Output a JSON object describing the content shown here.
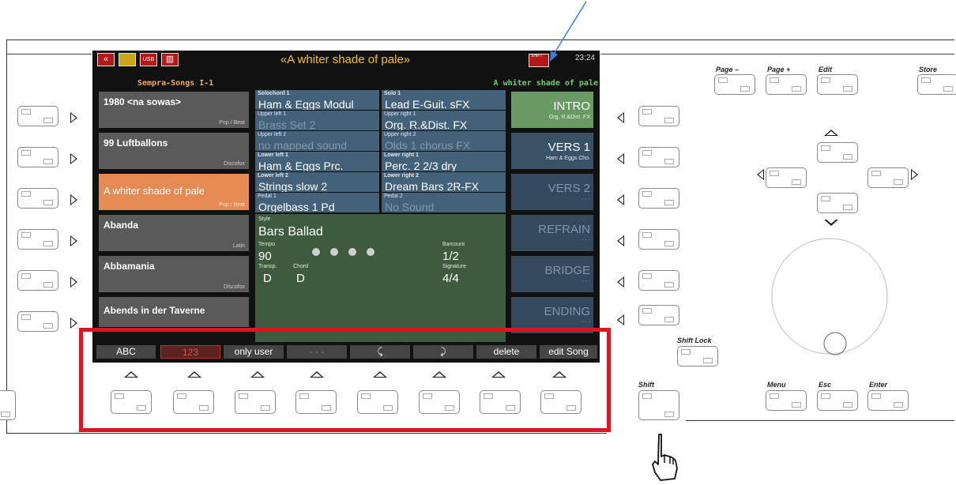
{
  "screen": {
    "song_title": "«A whiter shade of pale»",
    "clock": "23:24",
    "shift_label": "SHIFT",
    "menu_icon_label": "MENU",
    "usb_icon_label": "USB",
    "list_header": "Sempra-Songs I-1",
    "current_song": "A whiter shade of pale",
    "songs": [
      {
        "name": "1980 <na sowas>",
        "genre": "Pop / Beat"
      },
      {
        "name": "99 Luftballons",
        "genre": "Discofox"
      },
      {
        "name": "A whiter shade of pale",
        "genre": "Pop / Beat"
      },
      {
        "name": "Abanda",
        "genre": "Latin"
      },
      {
        "name": "Abbamania",
        "genre": "Discofox"
      },
      {
        "name": "Abends in der Taverne",
        "genre": ""
      }
    ],
    "voices": [
      {
        "label": "Solochord 1",
        "name": "Ham & Eggs Modul"
      },
      {
        "label": "Solo 1",
        "name": "Lead E-Guit. sFX"
      },
      {
        "label": "Upper left 1",
        "name": "Brass Set 2"
      },
      {
        "label": "Upper right 1",
        "name": "Org. R.&Dist. FX"
      },
      {
        "label": "Upper left 2",
        "name": "no mapped sound"
      },
      {
        "label": "Upper right 2",
        "name": "Olds 1 chorus FX"
      },
      {
        "label": "Lower left 1",
        "name": "Ham & Eggs Prc."
      },
      {
        "label": "Lower right 1",
        "name": "Perc. 2 2/3 dry"
      },
      {
        "label": "Lower left 2",
        "name": "Strings slow 2"
      },
      {
        "label": "Lower right 2",
        "name": "Dream Bars 2R-FX"
      },
      {
        "label": "Pedal 1",
        "name": "Orgelbass 1  Pd"
      },
      {
        "label": "Pedal 2",
        "name": "No Sound"
      }
    ],
    "style": {
      "label": "Style",
      "name": "Bars Ballad",
      "tempo_label": "Tempo",
      "tempo": "90",
      "barcount_label": "Barcount",
      "barcount": "1/2",
      "transp_label": "Transp.",
      "chord_label": "Chord",
      "signature_label": "Signature",
      "transp_value": "D",
      "chord_value": "D",
      "signature_value": "4/4"
    },
    "segments": [
      {
        "title": "INTRO",
        "sub": "Org. R.&Dist. FX"
      },
      {
        "title": "VERS 1",
        "sub": "Ham & Eggs Cho."
      },
      {
        "title": "VERS 2",
        "sub": "- - -"
      },
      {
        "title": "REFRAIN",
        "sub": "- - -"
      },
      {
        "title": "BRIDGE",
        "sub": "- - -"
      },
      {
        "title": "ENDING",
        "sub": "- - -"
      }
    ],
    "function_keys": [
      "ABC",
      "123",
      "only user",
      "- - -",
      "⤹",
      "⤸",
      "delete",
      "edit Song"
    ]
  },
  "panel": {
    "page_minus": "Page –",
    "page_plus": "Page +",
    "edit": "Edit",
    "store": "Store",
    "shift_lock": "Shift Lock",
    "shift": "Shift",
    "menu": "Menu",
    "esc": "Esc",
    "enter": "Enter"
  },
  "annotation": {
    "highlight_color": "#e0141e",
    "arrow_color": "#3b7fd4"
  }
}
